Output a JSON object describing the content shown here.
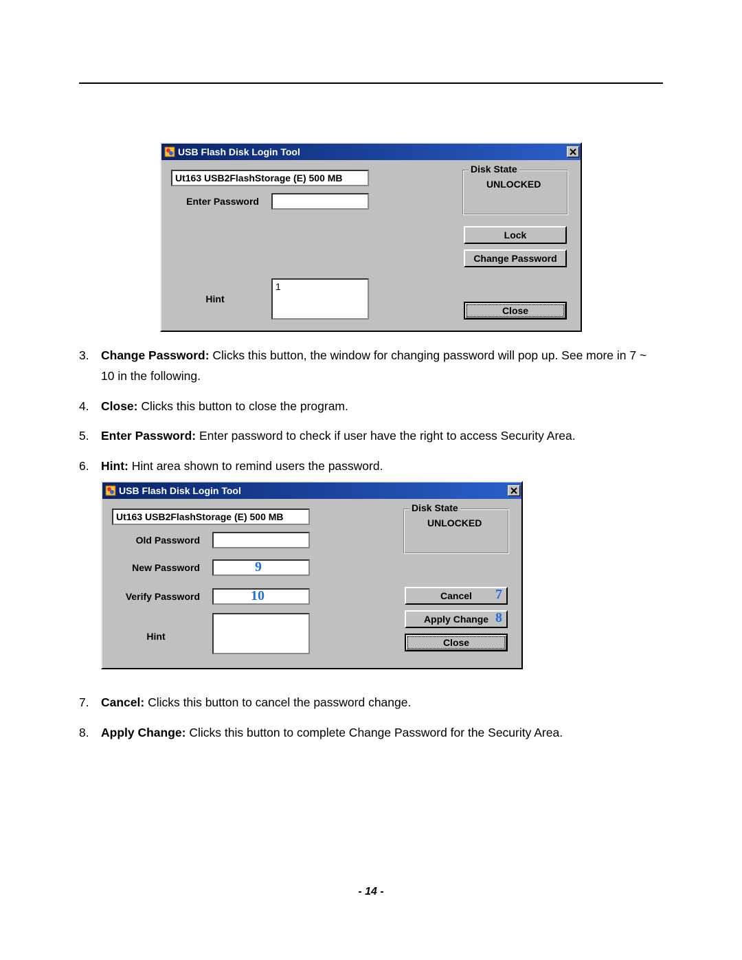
{
  "dialog1": {
    "title": "USB Flash Disk Login Tool",
    "device": "Ut163    USB2FlashStorage (E)  500 MB",
    "labels": {
      "enter_password": "Enter Password",
      "hint": "Hint"
    },
    "inputs": {
      "password": "",
      "hint": "1"
    },
    "group": {
      "title": "Disk State",
      "value": "UNLOCKED"
    },
    "buttons": {
      "lock": "Lock",
      "change_password": "Change Password",
      "close": "Close"
    }
  },
  "list1": {
    "i3_num": "3.",
    "i3_bold": "Change Password:",
    "i3_rest": " Clicks this button, the window for changing password will pop up. See more in 7 ~ 10 in the following.",
    "i4_num": "4.",
    "i4_bold": "Close:",
    "i4_rest": " Clicks this button to close the program.",
    "i5_num": "5.",
    "i5_bold": "Enter Password:",
    "i5_rest": " Enter password to check if user have the right to access Security Area.",
    "i6_num": "6.",
    "i6_bold": "Hint:",
    "i6_rest": " Hint area shown to remind users the password."
  },
  "dialog2": {
    "title": "USB Flash Disk Login Tool",
    "device": "Ut163    USB2FlashStorage (E)  500 MB",
    "labels": {
      "old_password": "Old Password",
      "new_password": "New Password",
      "verify_password": "Verify Password",
      "hint": "Hint"
    },
    "inputs": {
      "old": "",
      "new": "",
      "verify": "",
      "hint": ""
    },
    "group": {
      "title": "Disk State",
      "value": "UNLOCKED"
    },
    "buttons": {
      "cancel": "Cancel",
      "apply_change": "Apply Change",
      "close": "Close"
    },
    "callouts": {
      "c7": "7",
      "c8": "8",
      "c9": "9",
      "c10": "10"
    }
  },
  "list2": {
    "i7_num": "7.",
    "i7_bold": "Cancel:",
    "i7_rest": " Clicks this button to cancel the password change.",
    "i8_num": "8.",
    "i8_bold": "Apply Change:",
    "i8_rest": " Clicks this button to complete Change Password for the Security Area."
  },
  "footer": "- 14 -"
}
